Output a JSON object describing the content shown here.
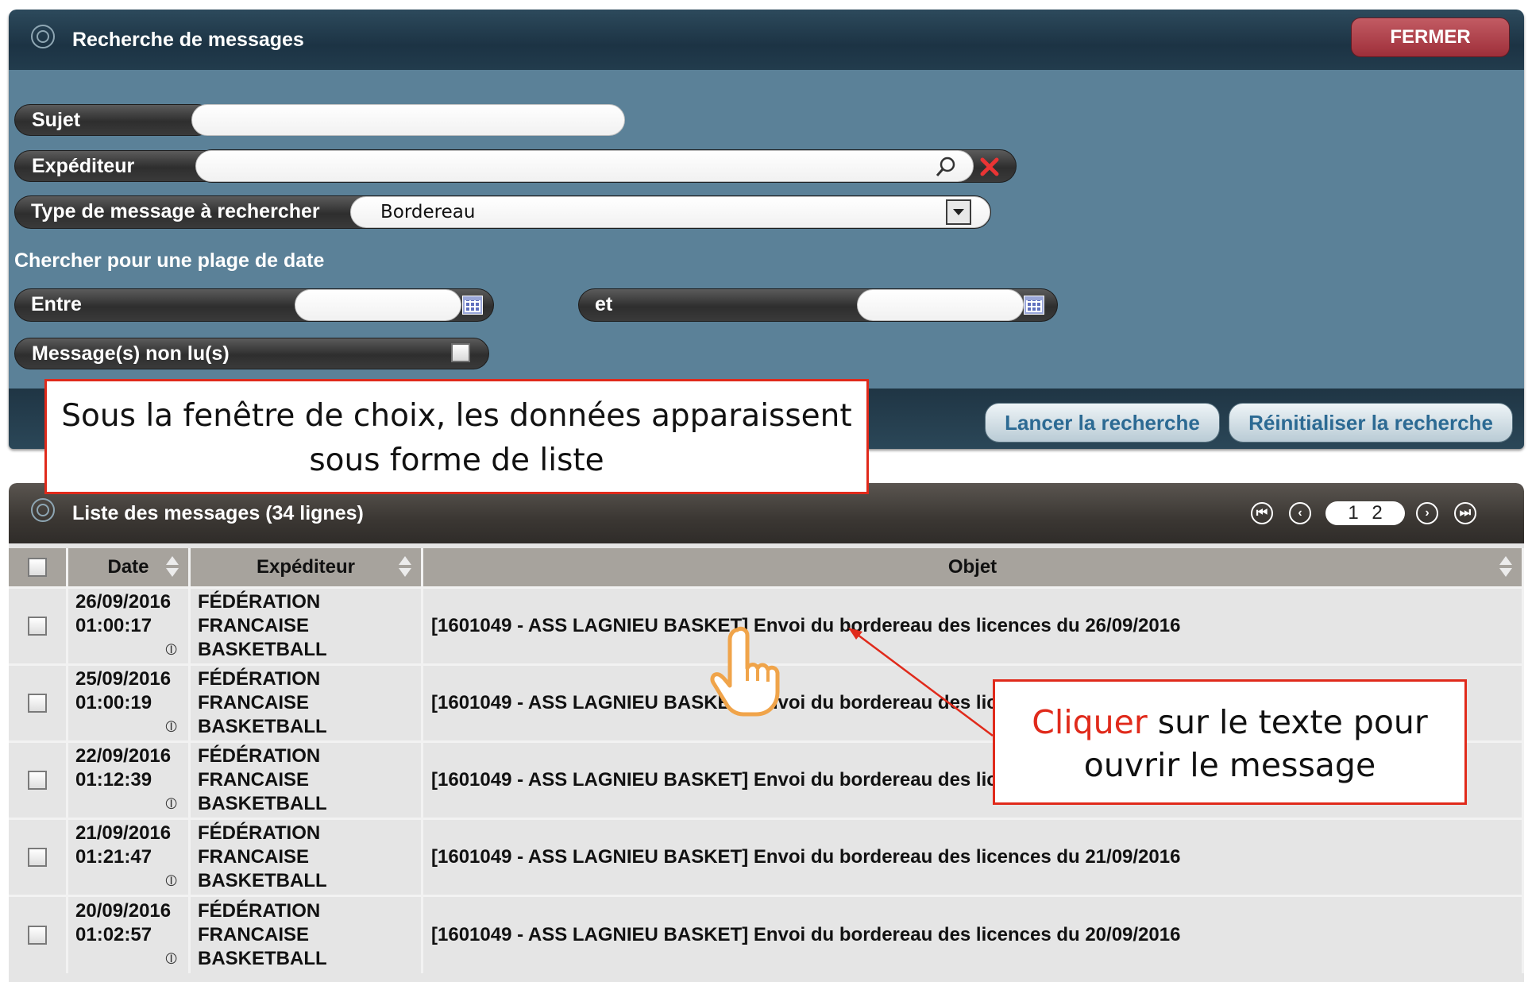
{
  "search": {
    "title": "Recherche de messages",
    "close_label": "FERMER",
    "subject_label": "Sujet",
    "subject_value": "",
    "sender_label": "Expéditeur",
    "sender_value": "",
    "type_label": "Type de message à rechercher",
    "type_value": "Bordereau",
    "date_range_heading": "Chercher pour une plage de date",
    "between_label": "Entre",
    "and_label": "et",
    "between_value": "",
    "and_value": "",
    "unread_label": "Message(s) non lu(s)",
    "search_button": "Lancer la recherche",
    "reset_button": "Réinitialiser la recherche",
    "icons": [
      "search-icon",
      "clear-icon",
      "calendar-icon",
      "chevron-down-icon"
    ]
  },
  "list": {
    "title": "Liste des messages (34 lignes)",
    "pages": "1 2",
    "pager_icons": [
      "first-page-icon",
      "prev-page-icon",
      "next-page-icon",
      "last-page-icon"
    ],
    "columns": [
      "Date",
      "Expéditeur",
      "Objet"
    ],
    "rows": [
      {
        "date": "26/09/2016",
        "time": "01:00:17",
        "sender": [
          "FÉDÉRATION",
          "FRANCAISE",
          "BASKETBALL"
        ],
        "subject": "[1601049 - ASS LAGNIEU BASKET] Envoi du bordereau des licences du 26/09/2016"
      },
      {
        "date": "25/09/2016",
        "time": "01:00:19",
        "sender": [
          "FÉDÉRATION",
          "FRANCAISE",
          "BASKETBALL"
        ],
        "subject": "[1601049 - ASS LAGNIEU BASKET] Envoi du bordereau des licen"
      },
      {
        "date": "22/09/2016",
        "time": "01:12:39",
        "sender": [
          "FÉDÉRATION",
          "FRANCAISE",
          "BASKETBALL"
        ],
        "subject": "[1601049 - ASS LAGNIEU BASKET] Envoi du bordereau des licen"
      },
      {
        "date": "21/09/2016",
        "time": "01:21:47",
        "sender": [
          "FÉDÉRATION",
          "FRANCAISE",
          "BASKETBALL"
        ],
        "subject": "[1601049 - ASS LAGNIEU BASKET] Envoi du bordereau des licences du 21/09/2016"
      },
      {
        "date": "20/09/2016",
        "time": "01:02:57",
        "sender": [
          "FÉDÉRATION",
          "FRANCAISE",
          "BASKETBALL"
        ],
        "subject": "[1601049 - ASS LAGNIEU BASKET] Envoi du bordereau des licences du 20/09/2016"
      }
    ]
  },
  "annotations": {
    "list_note_line1": "Sous la fenêtre de choix, les données apparaissent",
    "list_note_line2": "sous forme de liste",
    "click_note_highlight": "Cliquer",
    "click_note_rest": " sur le texte pour",
    "click_note_line2": "ouvrir le message",
    "highlight_color": "#e02a1b"
  }
}
